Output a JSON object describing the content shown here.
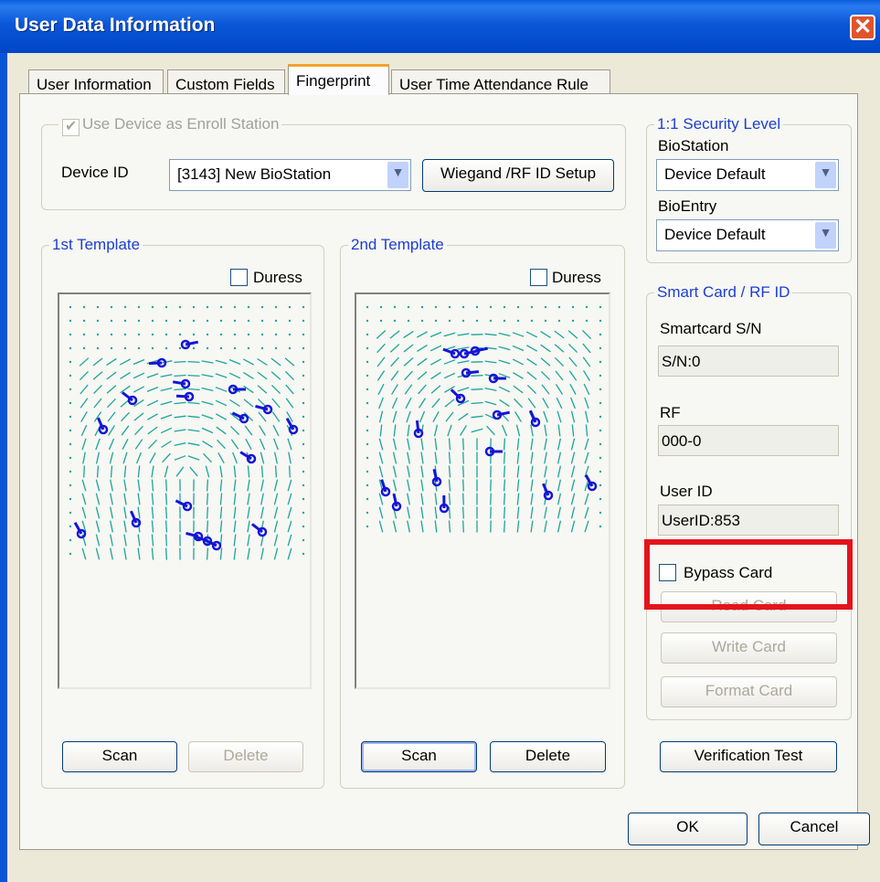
{
  "window": {
    "title": "User Data Information"
  },
  "tabs": [
    {
      "label": "User Information",
      "active": false
    },
    {
      "label": "Custom Fields",
      "active": false
    },
    {
      "label": "Fingerprint",
      "active": true
    },
    {
      "label": "User Time Attendance Rule",
      "active": false
    }
  ],
  "enroll": {
    "checkbox_label": "Use Device as Enroll Station",
    "checked": true,
    "device_id_label": "Device ID",
    "device_id_value": "[3143] New BioStation",
    "wiegand_button": "Wiegand /RF ID Setup"
  },
  "security": {
    "group_label": "1:1 Security Level",
    "biostation_label": "BioStation",
    "biostation_value": "Device Default",
    "bioentry_label": "BioEntry",
    "bioentry_value": "Device Default"
  },
  "template1": {
    "label": "1st Template",
    "duress_label": "Duress",
    "scan_button": "Scan",
    "delete_button": "Delete"
  },
  "template2": {
    "label": "2nd Template",
    "duress_label": "Duress",
    "scan_button": "Scan",
    "delete_button": "Delete"
  },
  "smartcard": {
    "group_label": "Smart Card / RF ID",
    "sn_label": "Smartcard S/N",
    "sn_value": "S/N:0",
    "rf_label": "RF",
    "rf_value": "000-0",
    "userid_label": "User ID",
    "userid_value": "UserID:853",
    "bypass_label": "Bypass Card",
    "read_button": "Read Card",
    "write_button": "Write Card",
    "format_button": "Format Card"
  },
  "verification_button": "Verification Test",
  "ok_button": "OK",
  "cancel_button": "Cancel",
  "colors": {
    "title_bar": "#0a57d8",
    "group_label": "#1c3ed0",
    "ridge": "#1aa59a",
    "minutia": "#1414d8",
    "highlight": "#e4141b"
  }
}
